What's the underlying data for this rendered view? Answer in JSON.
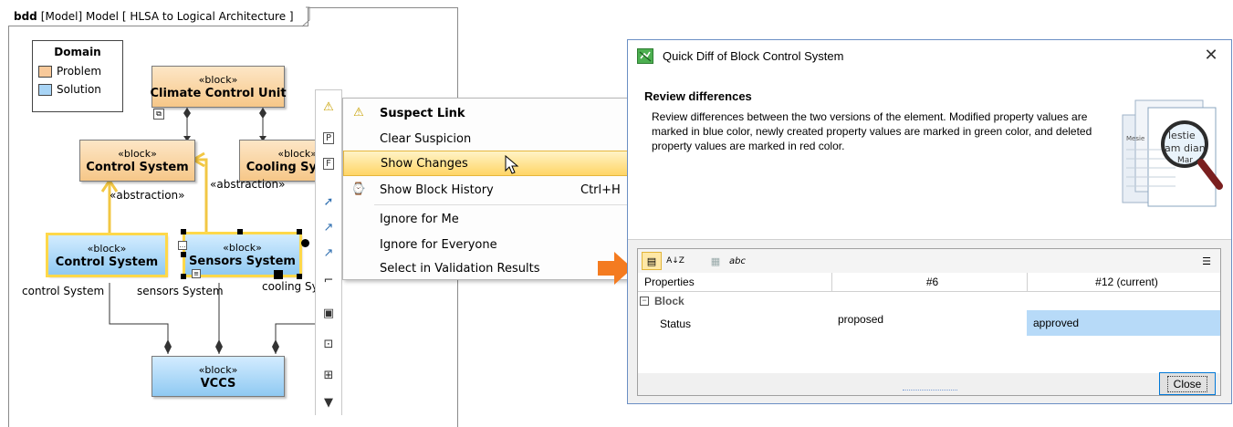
{
  "diagram": {
    "frame_kind": "bdd",
    "frame_title": "[Model] Model [ HLSA to Logical Architecture ]",
    "legend": {
      "title": "Domain",
      "items": [
        {
          "label": "Problem",
          "color": "#f8c99a"
        },
        {
          "label": "Solution",
          "color": "#a8d4f5"
        }
      ]
    },
    "blocks": {
      "climate_control_unit": {
        "stereotype": "«block»",
        "name": "Climate Control Unit"
      },
      "control_system_problem": {
        "stereotype": "«block»",
        "name": "Control System"
      },
      "cooling_system_problem": {
        "stereotype": "«block»",
        "name": "Cooling Sy"
      },
      "control_system_solution": {
        "stereotype": "«block»",
        "name": "Control System"
      },
      "sensors_system_solution": {
        "stereotype": "«block»",
        "name": "Sensors System"
      },
      "vccs": {
        "stereotype": "«block»",
        "name": "VCCS"
      }
    },
    "abstraction_labels": [
      "«abstraction»",
      "«abstraction»"
    ],
    "role_labels": [
      "control System",
      "sensors System",
      "cooling Sy"
    ]
  },
  "context_menu": {
    "items": [
      {
        "label": "Suspect Link",
        "icon": "warning-icon",
        "bold": true
      },
      {
        "label": "Clear Suspicion"
      },
      {
        "label": "Show Changes",
        "hover": true
      },
      {
        "label": "Show Block History",
        "shortcut": "Ctrl+H",
        "icon": "history-icon"
      },
      {
        "label": "Ignore for Me"
      },
      {
        "label": "Ignore for Everyone"
      },
      {
        "label": "Select in Validation Results"
      }
    ]
  },
  "dialog": {
    "title": "Quick Diff of Block Control System",
    "header_title": "Review differences",
    "header_text": "Review differences between the two versions of the element. Modified property values are marked in blue color, newly created property values are marked in green color, and deleted property values are marked in red color.",
    "illustration_words": [
      "Mesie",
      "lestie",
      "am dian",
      "Mar"
    ],
    "toolbar_glyphs": {
      "sort_az": "A↓Z",
      "spell": "abc"
    },
    "table": {
      "headers": [
        "Properties",
        "#6",
        "#12 (current)"
      ],
      "group": "Block",
      "rows": [
        {
          "property": "Status",
          "old": "proposed",
          "new": "approved"
        }
      ]
    },
    "close_label": "Close",
    "colors": {
      "modified": "#b7daf8",
      "accent": "#0078d7"
    }
  }
}
